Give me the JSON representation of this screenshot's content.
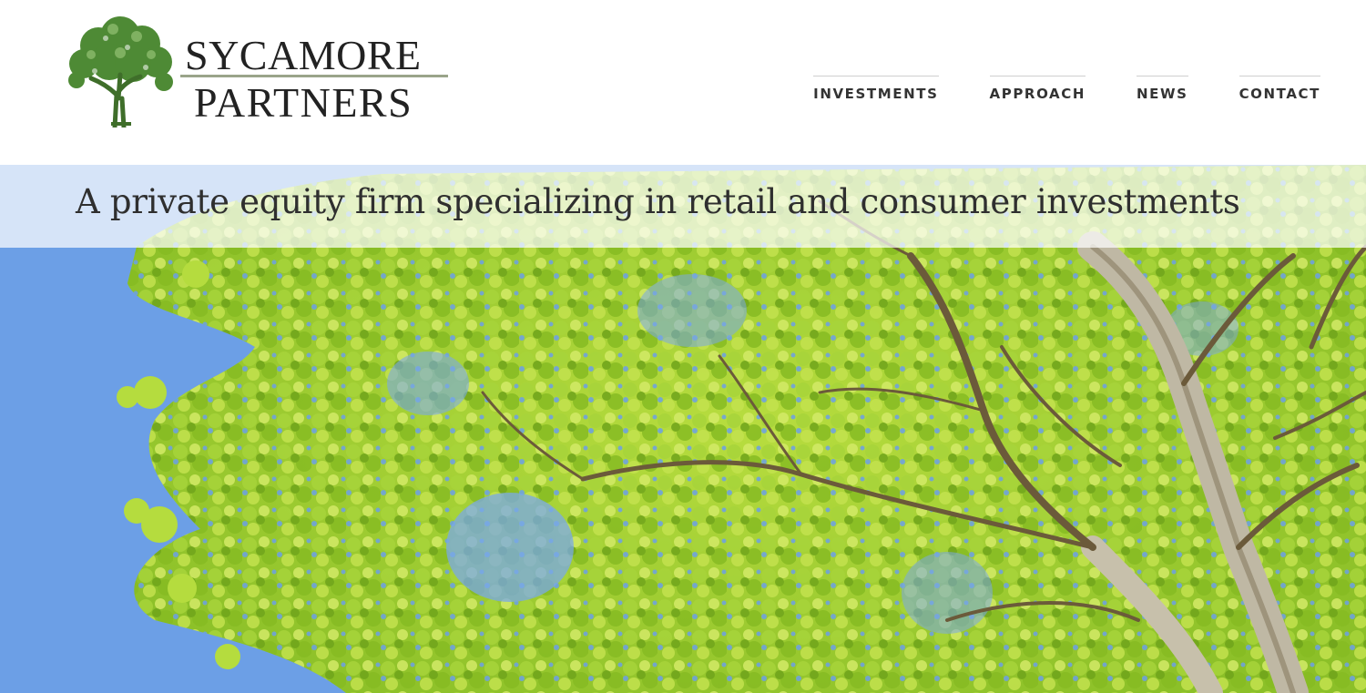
{
  "logo": {
    "line1": "SYCAMORE",
    "line2": "PARTNERS",
    "icon": "sycamore-tree-icon"
  },
  "nav": {
    "items": [
      {
        "label": "INVESTMENTS"
      },
      {
        "label": "APPROACH"
      },
      {
        "label": "NEWS"
      },
      {
        "label": "CONTACT"
      }
    ]
  },
  "hero": {
    "tagline": "A private equity firm specializing in retail and consumer investments",
    "image": "sycamore-tree-canopy-photo"
  },
  "colors": {
    "sky": "#6c9fe6",
    "leaf": "#9ccc2c",
    "leaf_light": "#cfe86a",
    "branch": "#6b5a3a",
    "logo_green": "#3f7a2a",
    "text": "#333333"
  }
}
